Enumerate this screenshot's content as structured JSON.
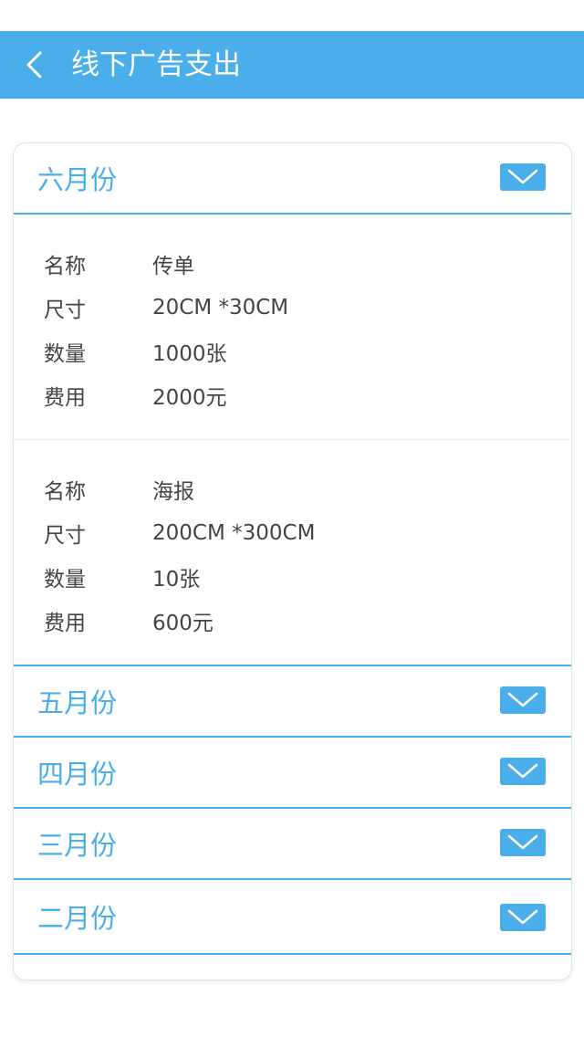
{
  "header": {
    "title": "线下广告支出"
  },
  "sections": [
    {
      "title": "六月份",
      "expanded": true,
      "items": [
        {
          "rows": [
            {
              "label": "名称",
              "value": "传单"
            },
            {
              "label": "尺寸",
              "value": "20CM *30CM"
            },
            {
              "label": "数量",
              "value": "1000张"
            },
            {
              "label": "费用",
              "value": "2000元"
            }
          ]
        },
        {
          "rows": [
            {
              "label": "名称",
              "value": "海报"
            },
            {
              "label": "尺寸",
              "value": "200CM *300CM"
            },
            {
              "label": "数量",
              "value": "10张"
            },
            {
              "label": "费用",
              "value": "600元"
            }
          ]
        }
      ]
    },
    {
      "title": "五月份",
      "expanded": false
    },
    {
      "title": "四月份",
      "expanded": false
    },
    {
      "title": "三月份",
      "expanded": false
    },
    {
      "title": "二月份",
      "expanded": false
    }
  ],
  "colors": {
    "accent": "#4aaeea"
  }
}
